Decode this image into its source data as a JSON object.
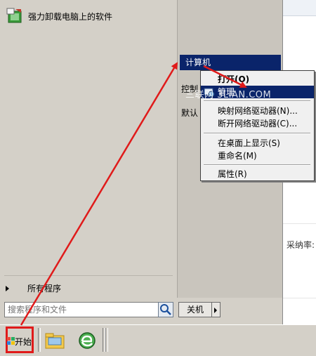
{
  "start_menu": {
    "pinned_program": "强力卸载电脑上的软件",
    "all_programs": "所有程序",
    "search_placeholder": "搜索程序和文件",
    "shutdown": "关机",
    "right_items": [
      {
        "label": "计算机"
      },
      {
        "label": "控制"
      },
      {
        "label": "默认"
      }
    ]
  },
  "context_menu": {
    "items": [
      {
        "label": "打开(O)"
      },
      {
        "label": "管理"
      },
      {
        "label": "映射网络驱动器(N)..."
      },
      {
        "label": "断开网络驱动器(C)..."
      },
      {
        "label": "在桌面上显示(S)"
      },
      {
        "label": "重命名(M)"
      },
      {
        "label": "属性(R)"
      }
    ]
  },
  "watermark": "三联网 3LIAN.COM",
  "background_window": {
    "adopt_rate_label": "采纳率:"
  },
  "taskbar": {
    "start_label": "开始"
  },
  "colors": {
    "highlight": "#0a246a",
    "annotation_red": "#e01a1a",
    "menu_bg": "#d4d0c8"
  }
}
